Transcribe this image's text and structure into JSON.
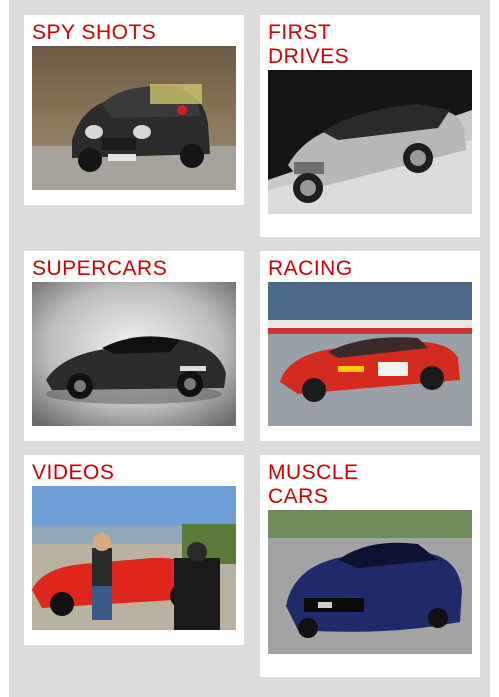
{
  "categories": [
    {
      "label": "SPY SHOTS"
    },
    {
      "label": "FIRST DRIVES"
    },
    {
      "label": "SUPERCARS"
    },
    {
      "label": "RACING"
    },
    {
      "label": "VIDEOS"
    },
    {
      "label": "MUSCLE CARS"
    }
  ]
}
